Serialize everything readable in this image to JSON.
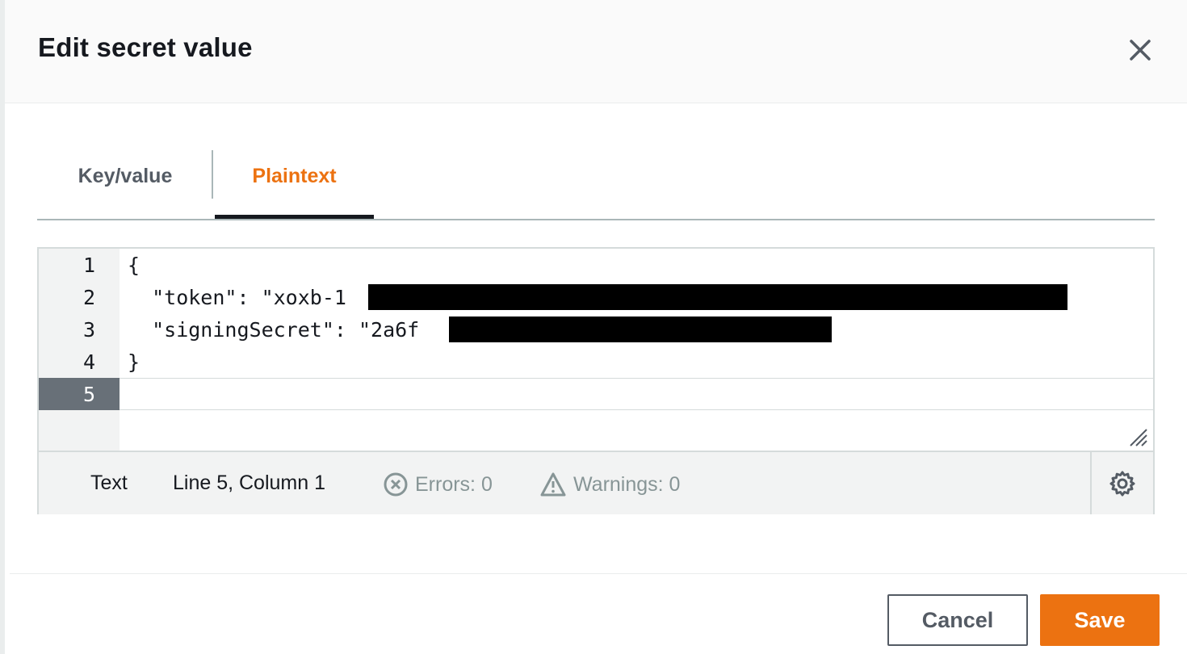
{
  "modal": {
    "title": "Edit secret value",
    "close_icon": "close-icon"
  },
  "tabs": [
    {
      "label": "Key/value",
      "active": false
    },
    {
      "label": "Plaintext",
      "active": true
    }
  ],
  "editor": {
    "line_numbers": [
      "1",
      "2",
      "3",
      "4",
      "5"
    ],
    "lines": [
      "{",
      "  \"token\": \"xoxb-1                                      \",",
      "  \"signingSecret\": \"2a6f                    9\"",
      "}",
      ""
    ],
    "active_line": 5
  },
  "status": {
    "mode": "Text",
    "position": "Line 5, Column 1",
    "errors": "Errors: 0",
    "warnings": "Warnings: 0",
    "error_icon": "error-circle-icon",
    "warning_icon": "warning-triangle-icon",
    "settings_icon": "gear-icon"
  },
  "footer": {
    "cancel_label": "Cancel",
    "save_label": "Save"
  },
  "colors": {
    "accent": "#ec7211",
    "text": "#16191f",
    "muted": "#879596"
  }
}
